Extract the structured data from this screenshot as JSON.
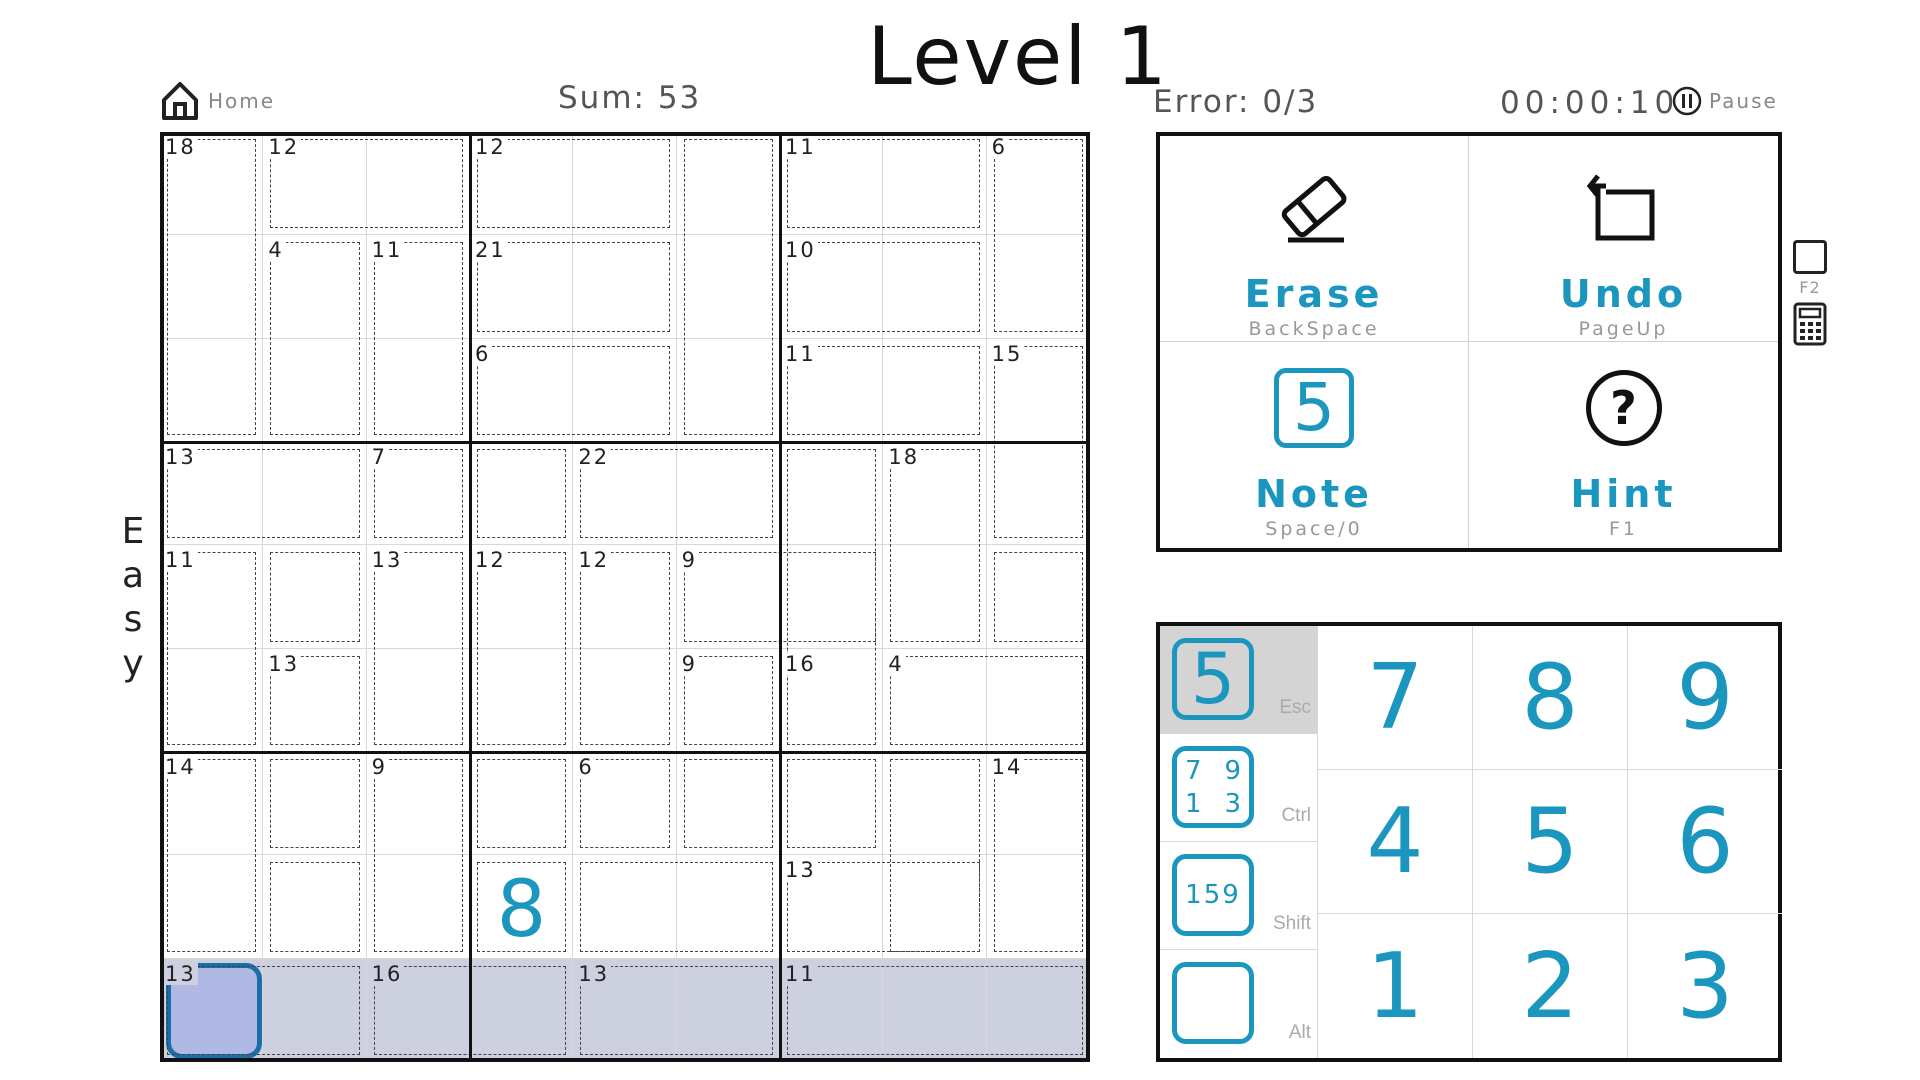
{
  "header": {
    "title": "Level 1",
    "home_label": "Home",
    "sum_label": "Sum: 53",
    "error_label": "Error: 0/3",
    "timer": "00:00:10",
    "pause_label": "Pause"
  },
  "difficulty": [
    "E",
    "a",
    "s",
    "y"
  ],
  "board": {
    "cage_sums": [
      {
        "r": 0,
        "c": 0,
        "v": "18"
      },
      {
        "r": 0,
        "c": 1,
        "v": "12"
      },
      {
        "r": 0,
        "c": 3,
        "v": "12"
      },
      {
        "r": 0,
        "c": 6,
        "v": "11"
      },
      {
        "r": 0,
        "c": 8,
        "v": "6"
      },
      {
        "r": 1,
        "c": 1,
        "v": "4"
      },
      {
        "r": 1,
        "c": 2,
        "v": "11"
      },
      {
        "r": 1,
        "c": 3,
        "v": "21"
      },
      {
        "r": 1,
        "c": 6,
        "v": "10"
      },
      {
        "r": 2,
        "c": 3,
        "v": "6"
      },
      {
        "r": 2,
        "c": 6,
        "v": "11"
      },
      {
        "r": 2,
        "c": 8,
        "v": "15"
      },
      {
        "r": 3,
        "c": 0,
        "v": "13"
      },
      {
        "r": 3,
        "c": 2,
        "v": "7"
      },
      {
        "r": 3,
        "c": 4,
        "v": "22"
      },
      {
        "r": 3,
        "c": 7,
        "v": "18"
      },
      {
        "r": 4,
        "c": 0,
        "v": "11"
      },
      {
        "r": 4,
        "c": 2,
        "v": "13"
      },
      {
        "r": 4,
        "c": 3,
        "v": "12"
      },
      {
        "r": 4,
        "c": 4,
        "v": "12"
      },
      {
        "r": 4,
        "c": 5,
        "v": "9"
      },
      {
        "r": 5,
        "c": 1,
        "v": "13"
      },
      {
        "r": 5,
        "c": 5,
        "v": "9"
      },
      {
        "r": 5,
        "c": 6,
        "v": "16"
      },
      {
        "r": 5,
        "c": 7,
        "v": "4"
      },
      {
        "r": 6,
        "c": 0,
        "v": "14"
      },
      {
        "r": 6,
        "c": 2,
        "v": "9"
      },
      {
        "r": 6,
        "c": 4,
        "v": "6"
      },
      {
        "r": 6,
        "c": 8,
        "v": "14"
      },
      {
        "r": 7,
        "c": 6,
        "v": "13"
      },
      {
        "r": 8,
        "c": 0,
        "v": "13"
      },
      {
        "r": 8,
        "c": 2,
        "v": "16"
      },
      {
        "r": 8,
        "c": 4,
        "v": "13"
      },
      {
        "r": 8,
        "c": 6,
        "v": "11"
      }
    ],
    "placed_digits": [
      {
        "r": 7,
        "c": 3,
        "v": "8"
      }
    ],
    "selected_cell": {
      "r": 8,
      "c": 0
    },
    "highlight_row": 8,
    "highlight_color": "#cdd0df",
    "selected_color": "#b0b9e3",
    "digit_color": "#1a96bf"
  },
  "actions": [
    {
      "label": "Erase",
      "key": "BackSpace",
      "icon": "eraser-icon"
    },
    {
      "label": "Undo",
      "key": "PageUp",
      "icon": "undo-icon"
    },
    {
      "label": "Note",
      "key": "Space/0",
      "icon": "note-icon",
      "icon_text": "5"
    },
    {
      "label": "Hint",
      "key": "F1",
      "icon": "hint-icon",
      "icon_text": "?"
    }
  ],
  "side": {
    "f2_label": "F2",
    "icons": [
      "checkbox-icon",
      "calculator-icon"
    ]
  },
  "numpad": {
    "modes": [
      {
        "key": "Esc",
        "icon": "normal-mode-icon",
        "text": "5",
        "active": true
      },
      {
        "key": "Ctrl",
        "icon": "corner-notes-icon",
        "text": [
          "7",
          "9",
          "1",
          "3"
        ]
      },
      {
        "key": "Shift",
        "icon": "center-notes-icon",
        "text": "159"
      },
      {
        "key": "Alt",
        "icon": "color-mode-icon",
        "colors": [
          "#c8184a",
          "#1c3bc8",
          "#1aa840",
          "#c8c418"
        ]
      }
    ],
    "digits": [
      "7",
      "8",
      "9",
      "4",
      "5",
      "6",
      "1",
      "2",
      "3"
    ]
  }
}
